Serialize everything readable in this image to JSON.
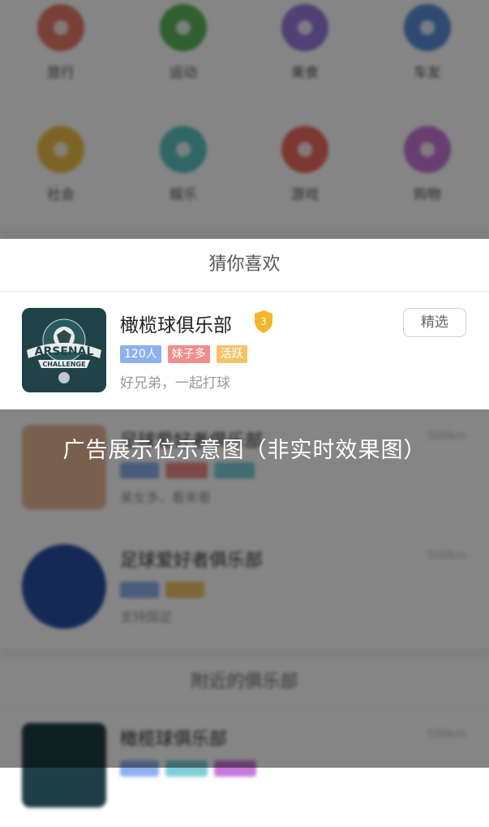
{
  "categories": [
    {
      "label": "旅行",
      "color": "#e97b6b"
    },
    {
      "label": "运动",
      "color": "#5cb85c"
    },
    {
      "label": "美食",
      "color": "#9b7be0"
    },
    {
      "label": "车友",
      "color": "#5b8fd9"
    },
    {
      "label": "社会",
      "color": "#f0c04a"
    },
    {
      "label": "娱乐",
      "color": "#5cc5c4"
    },
    {
      "label": "游戏",
      "color": "#ef6b5e"
    },
    {
      "label": "购物",
      "color": "#c778d8"
    }
  ],
  "recommend": {
    "header": "猜你喜欢",
    "club": {
      "title": "橄榄球俱乐部",
      "level": "3",
      "tags": [
        {
          "label": "120人",
          "color": "#8fb0ee"
        },
        {
          "label": "妹子多",
          "color": "#f08d8d"
        },
        {
          "label": "活跃",
          "color": "#f4c46a"
        }
      ],
      "subtitle": "好兄弟，一起打球",
      "button": "精选"
    }
  },
  "background_list": {
    "rows": [
      {
        "title": "足球爱好者俱乐部",
        "subtitle": "美女多，看来看",
        "distance": "500km"
      },
      {
        "title": "足球爱好者俱乐部",
        "subtitle": "支持国足",
        "distance": "500km"
      }
    ],
    "nearby_header": "附近的俱乐部",
    "nearby_row": {
      "title": "橄榄球俱乐部",
      "distance": "500km"
    }
  },
  "caption": "广告展示位示意图（非实时效果图）",
  "thumb_text": {
    "top": "ARSENAL",
    "bottom": "CHALLENGE"
  }
}
